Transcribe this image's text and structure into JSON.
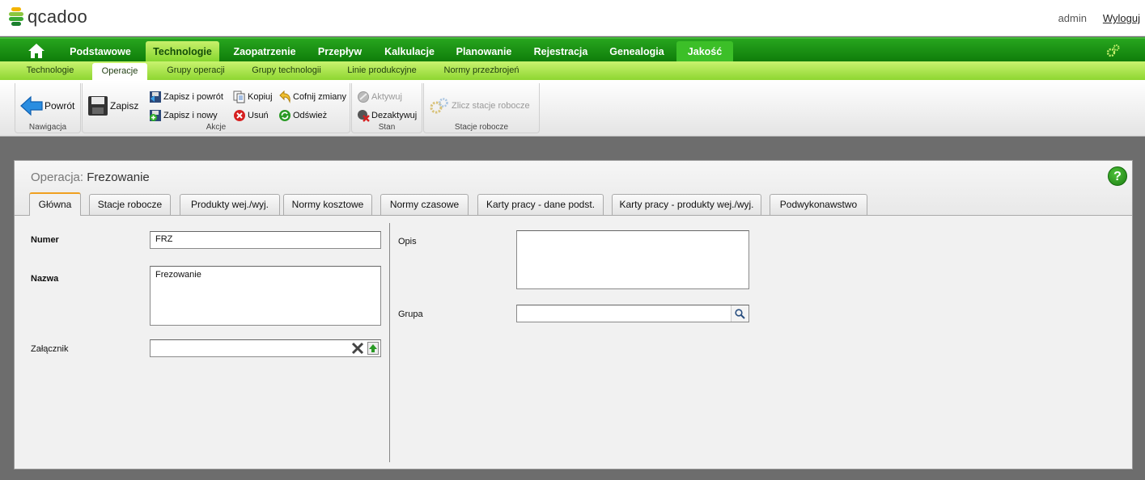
{
  "app": {
    "logo": "qcadoo",
    "user": "admin",
    "logout": "Wyloguj"
  },
  "mainnav": {
    "items": [
      "Podstawowe",
      "Technologie",
      "Zaopatrzenie",
      "Przepływ",
      "Kalkulacje",
      "Planowanie",
      "Rejestracja",
      "Genealogia",
      "Jakość"
    ],
    "active": "Technologie"
  },
  "subnav": {
    "items": [
      "Technologie",
      "Operacje",
      "Grupy operacji",
      "Grupy technologii",
      "Linie produkcyjne",
      "Normy przezbrojeń"
    ],
    "active": "Operacje"
  },
  "ribbon": {
    "nawigacja": {
      "label": "Nawigacja",
      "back": "Powrót"
    },
    "akcje": {
      "label": "Akcje",
      "save": "Zapisz",
      "save_back": "Zapisz i powrót",
      "save_new": "Zapisz i nowy",
      "copy": "Kopiuj",
      "delete": "Usuń",
      "undo": "Cofnij zmiany",
      "refresh": "Odśwież"
    },
    "stan": {
      "label": "Stan",
      "activate": "Aktywuj",
      "deactivate": "Dezaktywuj"
    },
    "stacje": {
      "label": "Stacje robocze",
      "count": "Zlicz stacje robocze"
    }
  },
  "form": {
    "title_prefix": "Operacja:",
    "title_value": "Frezowanie",
    "help": "?",
    "tabs": [
      "Główna",
      "Stacje robocze",
      "Produkty wej./wyj.",
      "Normy kosztowe",
      "Normy czasowe",
      "Karty pracy - dane podst.",
      "Karty pracy - produkty wej./wyj.",
      "Podwykonawstwo"
    ],
    "active_tab": "Główna",
    "fields": {
      "numer": {
        "label": "Numer",
        "value": "FRZ"
      },
      "nazwa": {
        "label": "Nazwa",
        "value": "Frezowanie"
      },
      "zalacznik": {
        "label": "Załącznik",
        "value": ""
      },
      "opis": {
        "label": "Opis",
        "value": ""
      },
      "grupa": {
        "label": "Grupa",
        "value": ""
      }
    }
  },
  "colors": {
    "nav_green": "#1a9114",
    "active_tab_accent": "#f0a020"
  }
}
